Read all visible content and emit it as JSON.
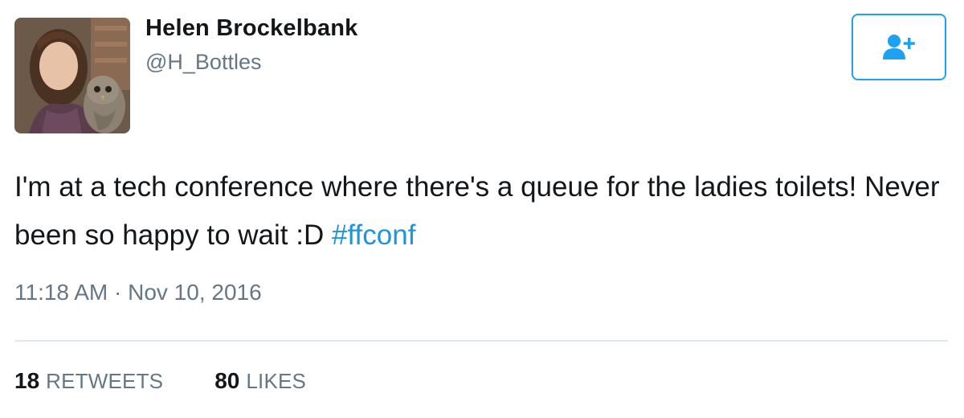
{
  "author": {
    "display_name": "Helen Brockelbank",
    "handle": "@H_Bottles"
  },
  "follow_button": {
    "icon": "follow-user-plus-icon"
  },
  "tweet": {
    "text": "I'm at a tech conference where there's a queue for the ladies toilets! Never been so happy to wait :D",
    "hashtag": "#ffconf",
    "timestamp": "11:18 AM · Nov 10, 2016"
  },
  "stats": {
    "retweets_count": "18",
    "retweets_label": "RETWEETS",
    "likes_count": "80",
    "likes_label": "LIKES"
  },
  "colors": {
    "accent": "#1da1f2",
    "hashtag": "#1b95e0",
    "text": "#14171a",
    "muted": "#657786",
    "divider": "#e1e8ed"
  }
}
